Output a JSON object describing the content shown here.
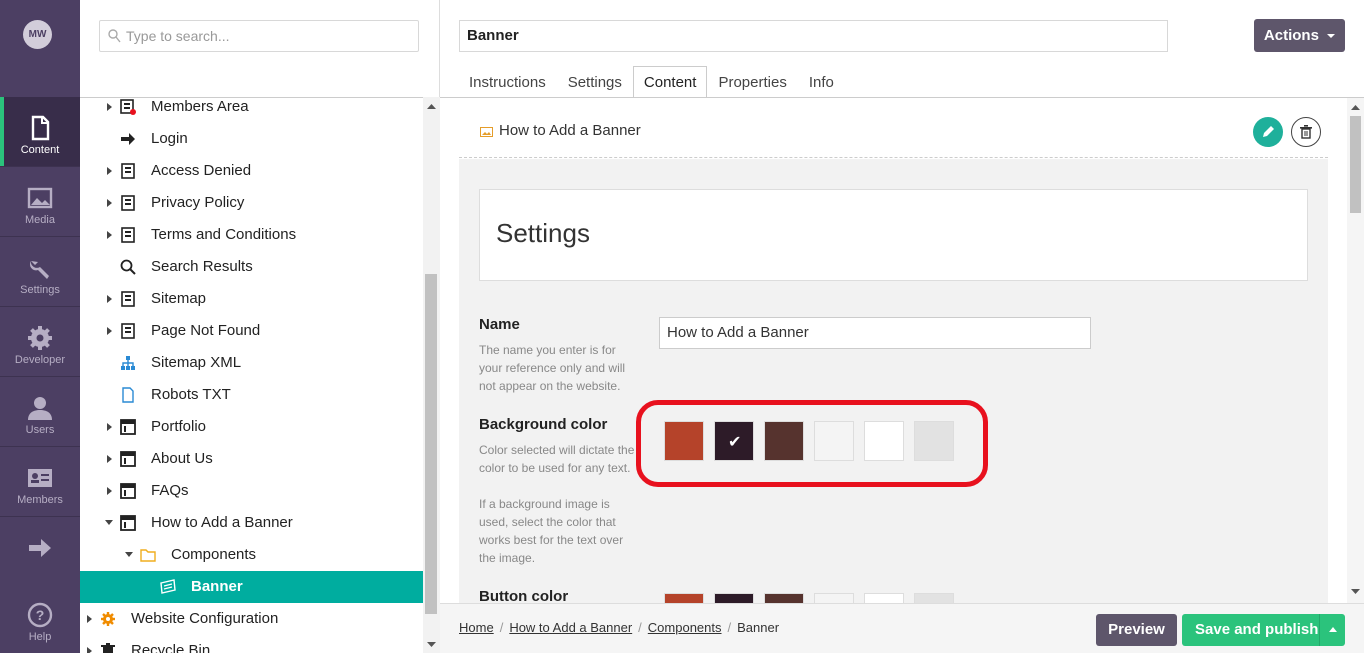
{
  "user": {
    "initials": "MW"
  },
  "sections": [
    {
      "label": "Content",
      "icon": "document-icon",
      "active": true
    },
    {
      "label": "Media",
      "icon": "image-icon"
    },
    {
      "label": "Settings",
      "icon": "wrench-icon"
    },
    {
      "label": "Developer",
      "icon": "gear-icon"
    },
    {
      "label": "Users",
      "icon": "user-icon"
    },
    {
      "label": "Members",
      "icon": "id-card-icon"
    },
    {
      "label": "",
      "icon": "arrow-right-icon"
    },
    {
      "label": "Help",
      "icon": "help-icon"
    }
  ],
  "tree": {
    "search_placeholder": "Type to search...",
    "nodes": [
      {
        "label": "Members Area"
      },
      {
        "label": "Login"
      },
      {
        "label": "Access Denied"
      },
      {
        "label": "Privacy Policy"
      },
      {
        "label": "Terms and Conditions"
      },
      {
        "label": "Search Results"
      },
      {
        "label": "Sitemap"
      },
      {
        "label": "Page Not Found"
      },
      {
        "label": "Sitemap XML"
      },
      {
        "label": "Robots TXT"
      },
      {
        "label": "Portfolio"
      },
      {
        "label": "About Us"
      },
      {
        "label": "FAQs"
      },
      {
        "label": "How to Add a Banner"
      },
      {
        "label": "Components"
      },
      {
        "label": "Banner"
      },
      {
        "label": "Website Configuration"
      },
      {
        "label": "Recycle Bin"
      }
    ]
  },
  "editor": {
    "node_name": "Banner",
    "actions_label": "Actions",
    "tabs": [
      "Instructions",
      "Settings",
      "Content",
      "Properties",
      "Info"
    ],
    "active_tab": "Content",
    "block_title": "How to Add a Banner",
    "settings_heading": "Settings",
    "fields": {
      "name_label": "Name",
      "name_desc": "The name you enter is for your reference only and will not appear on the website.",
      "name_value": "How to Add a Banner",
      "bg_label": "Background color",
      "bg_desc1": "Color selected will dictate the color to be used for any text.",
      "bg_desc2": "If a background image is used, select the color that works best for the text over the image.",
      "button_label": "Button color"
    },
    "swatches": [
      "#b5432a",
      "#2d1b28",
      "#56332e",
      "#f4f4f4",
      "#ffffff",
      "#e2e2e2"
    ],
    "selected_swatch_index": 1
  },
  "footer": {
    "breadcrumbs": [
      "Home",
      "How to Add a Banner",
      "Components",
      "Banner"
    ],
    "preview_label": "Preview",
    "publish_label": "Save and publish"
  }
}
